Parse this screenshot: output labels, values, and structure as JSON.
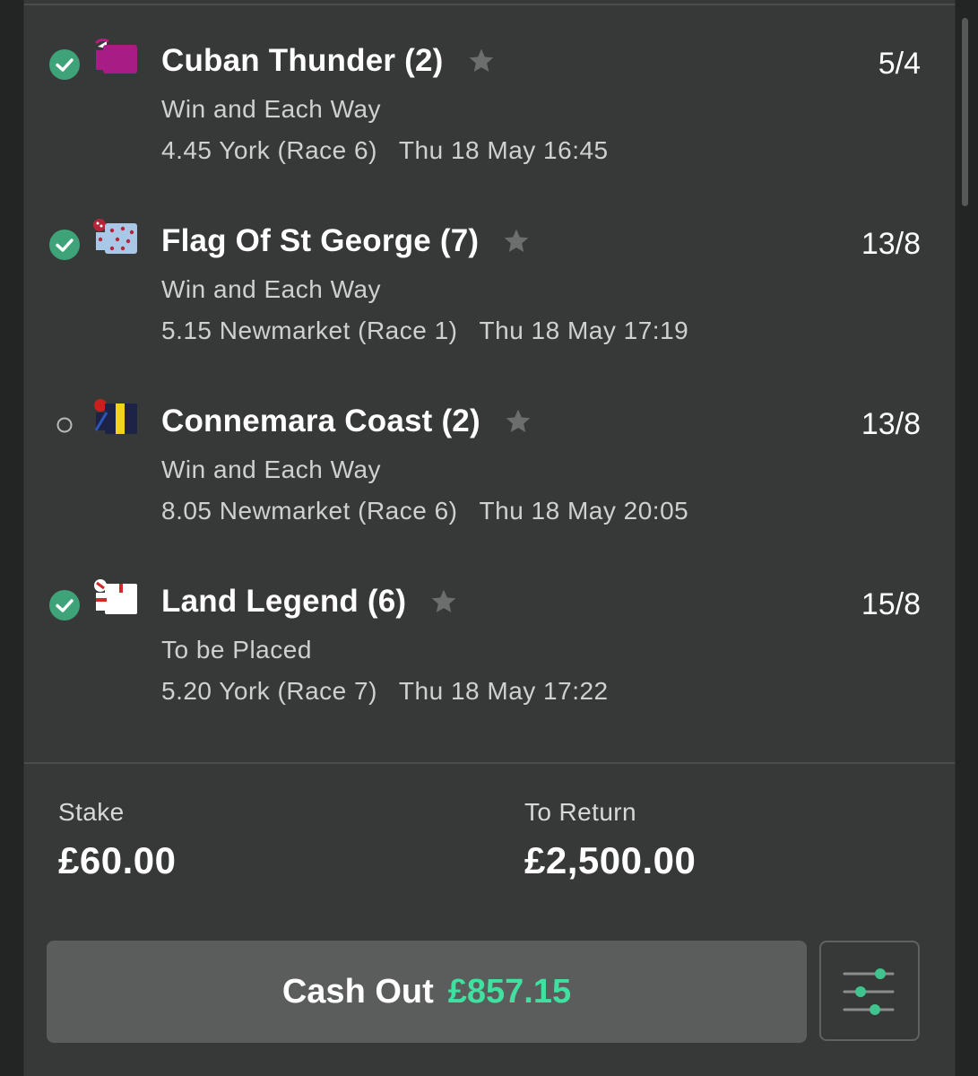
{
  "selections": [
    {
      "name": "Cuban Thunder (2)",
      "odds": "5/4",
      "market": "Win and Each Way",
      "race": "4.45 York (Race 6)",
      "datetime": "Thu 18 May 16:45",
      "status": "won",
      "silks_icon": "silks-magenta"
    },
    {
      "name": "Flag Of St George (7)",
      "odds": "13/8",
      "market": "Win and Each Way",
      "race": "5.15 Newmarket (Race 1)",
      "datetime": "Thu 18 May 17:19",
      "status": "won",
      "silks_icon": "silks-lightblue-spots"
    },
    {
      "name": "Connemara Coast (2)",
      "odds": "13/8",
      "market": "Win and Each Way",
      "race": "8.05 Newmarket (Race 6)",
      "datetime": "Thu 18 May 20:05",
      "status": "pending",
      "silks_icon": "silks-navy-yellow"
    },
    {
      "name": "Land Legend (6)",
      "odds": "15/8",
      "market": "To be Placed",
      "race": "5.20 York (Race 7)",
      "datetime": "Thu 18 May 17:22",
      "status": "won",
      "silks_icon": "silks-white-red"
    }
  ],
  "summary": {
    "stake_label": "Stake",
    "stake_value": "£60.00",
    "return_label": "To Return",
    "return_value": "£2,500.00"
  },
  "cashout": {
    "label": "Cash Out",
    "amount": "£857.15",
    "amount_color": "#3fe0a0"
  },
  "colors": {
    "won_check": "#3fa37a",
    "background": "#363937",
    "star": "#6b6e6c"
  }
}
